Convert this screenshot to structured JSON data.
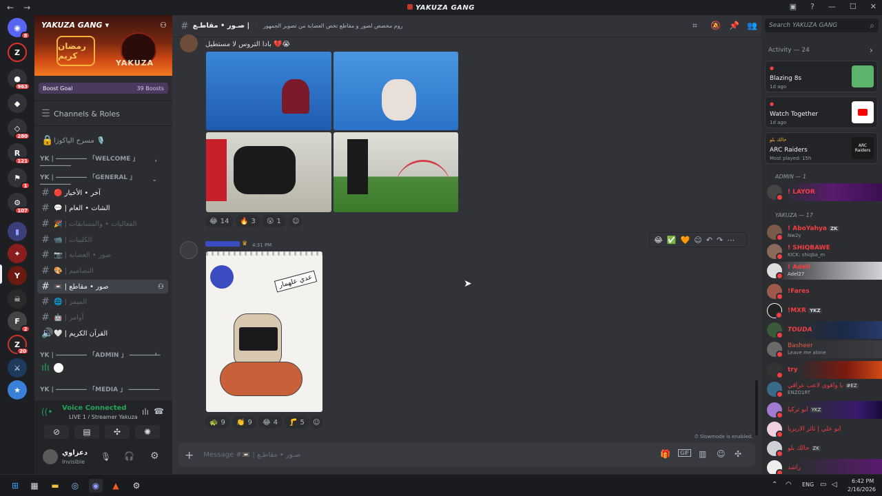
{
  "window": {
    "title": "YAKUZA GANG",
    "back": "←",
    "forward": "→"
  },
  "server_rail": {
    "badges": [
      "8",
      "963",
      "280",
      "121",
      "1",
      "107",
      "2",
      "20"
    ]
  },
  "server": {
    "name": "YAKUZA GANG",
    "banner_text": "YAKUZA",
    "banner_arabic": "رمضان كريم",
    "boost_goal": "Boost Goal",
    "boost_count": "39 Boosts",
    "channels_roles": "Channels & Roles"
  },
  "channels": [
    {
      "kind": "voice",
      "label": "مسرح الياكوزا 🎙️"
    },
    {
      "kind": "cat",
      "label": "YK | ――――― 「WELCOME 」 ―――――"
    },
    {
      "kind": "cat",
      "label": "YK | ――――― 「GENERAL 」 ―――――"
    },
    {
      "kind": "text",
      "label": "🔴 آخر • الأخبار"
    },
    {
      "kind": "text",
      "label": "💬 | الشات • العام"
    },
    {
      "kind": "text",
      "label": "🎉 | الفعاليات • والمسابقات"
    },
    {
      "kind": "text",
      "label": "📹 | الكليبات"
    },
    {
      "kind": "text",
      "label": "📷 | صور • العصابة"
    },
    {
      "kind": "text",
      "label": "🎨 | التصاميم"
    },
    {
      "kind": "text",
      "label": "📼 | صور • مقاطع"
    },
    {
      "kind": "text",
      "label": "🌐 | الميمز"
    },
    {
      "kind": "text",
      "label": "🤖 | أوامر"
    },
    {
      "kind": "voice",
      "label": "🤍 | القرآن الكريم"
    },
    {
      "kind": "cat",
      "label": "YK | ――――― 「ADMIN 」 ―――――"
    },
    {
      "kind": "cat",
      "label": "YK | ――――― 「MEDIA 」 ―――――"
    }
  ],
  "voice": {
    "status": "Voice Connected",
    "channel": "LIVE 1 / Streamer Yakuza"
  },
  "user": {
    "name": "دعزاوي",
    "status": "Invisible"
  },
  "topbar": {
    "channel_name": "صـور • مقاطـع |",
    "topic": "روم مخصص لصور و مقاطع تخص العصابة من تصوير الجمهور",
    "search_placeholder": "Search YAKUZA GANG"
  },
  "messages": {
    "m1_text": "بادا التروس لا مستطيل 💔😭",
    "m1_reactions": [
      {
        "emoji": "😂",
        "count": "14"
      },
      {
        "emoji": "🔥",
        "count": "3"
      },
      {
        "emoji": "😮",
        "count": "1"
      }
    ],
    "m2_time": "4:31 PM",
    "m2_reactions": [
      {
        "emoji": "🐢",
        "count": "9"
      },
      {
        "emoji": "👏",
        "count": "9"
      },
      {
        "emoji": "😂",
        "count": "4"
      },
      {
        "emoji": "🦵",
        "count": "5"
      }
    ],
    "m2_image_text": "عدي علهمار",
    "hover_emojis": [
      "😂",
      "✅",
      "🧡"
    ]
  },
  "slowmode": "Slowmode is enabled.",
  "composer_placeholder": "Message #📼 | صـور • مقاطـع",
  "activity": {
    "header": "Activity — 24",
    "cards": [
      {
        "title": "Blazing 8s",
        "sub": "1d ago"
      },
      {
        "title": "Watch Together",
        "sub": "1d ago"
      },
      {
        "tag": "حالك بلو",
        "title": "ARC Raiders",
        "sub": "Most played: 15h",
        "thumb": "ARC Raiders"
      }
    ]
  },
  "members": {
    "admin_header": "ADMIN — 1",
    "yakuza_header": "YAKUZA — 17",
    "list": [
      {
        "name": "! AboYahya",
        "badge": "ZK",
        "sub": "Nw2y"
      },
      {
        "name": "! SHIQBAWE",
        "sub": "KICK: shiqba_m"
      },
      {
        "name": "! Adell",
        "sub": "Adel27"
      },
      {
        "name": "!Fares",
        "sub": ""
      },
      {
        "name": "!MXR",
        "badge": "YKZ",
        "sub": ""
      },
      {
        "name": "TOUDA",
        "sub": ""
      },
      {
        "name": "Basheer",
        "sub": "Leave me alone"
      },
      {
        "name": "try",
        "sub": ""
      },
      {
        "name": "يا واقوى لاعب عراقي",
        "badge": "#EZ",
        "sub": "ENZO1RT"
      },
      {
        "name": "ابو تركيا",
        "badge": "YKZ",
        "sub": ""
      },
      {
        "name": "ابو علي | ثائر الاريزيا",
        "sub": ""
      },
      {
        "name": "حالك بلو",
        "badge": "ZK",
        "sub": ""
      },
      {
        "name": "راشد",
        "sub": ""
      }
    ]
  },
  "taskbar": {
    "lang": "ENG",
    "time": "6:42 PM",
    "date": "2/16/2026"
  }
}
